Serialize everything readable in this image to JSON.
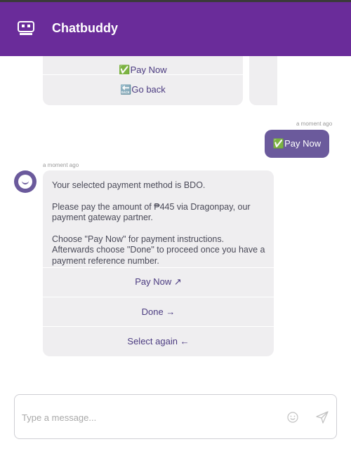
{
  "header": {
    "title": "Chatbuddy",
    "logo_icon": "robot-logo-icon",
    "bg_color": "#6a2c9a"
  },
  "carousel": {
    "buttons": [
      {
        "label": "✅Pay Now"
      },
      {
        "label": "🔙Go back"
      }
    ]
  },
  "user_message": {
    "timestamp": "a moment ago",
    "text": "✅Pay Now",
    "bg_color": "#6b5a9c"
  },
  "bot_message": {
    "timestamp": "a moment ago",
    "paragraphs": [
      "Your selected payment method is BDO.",
      "Please pay the amount of ₱445 via Dragonpay, our payment gateway partner.",
      "Choose \"Pay Now\" for payment instructions. Afterwards choose \"Done\" to proceed once you have a payment reference number."
    ],
    "buttons": [
      {
        "label": "Pay Now ↗"
      },
      {
        "label": "Done →"
      },
      {
        "label": "Select again  ←"
      }
    ]
  },
  "composer": {
    "placeholder": "Type a message...",
    "emoji_icon": "smiley-icon",
    "send_icon": "send-icon"
  }
}
